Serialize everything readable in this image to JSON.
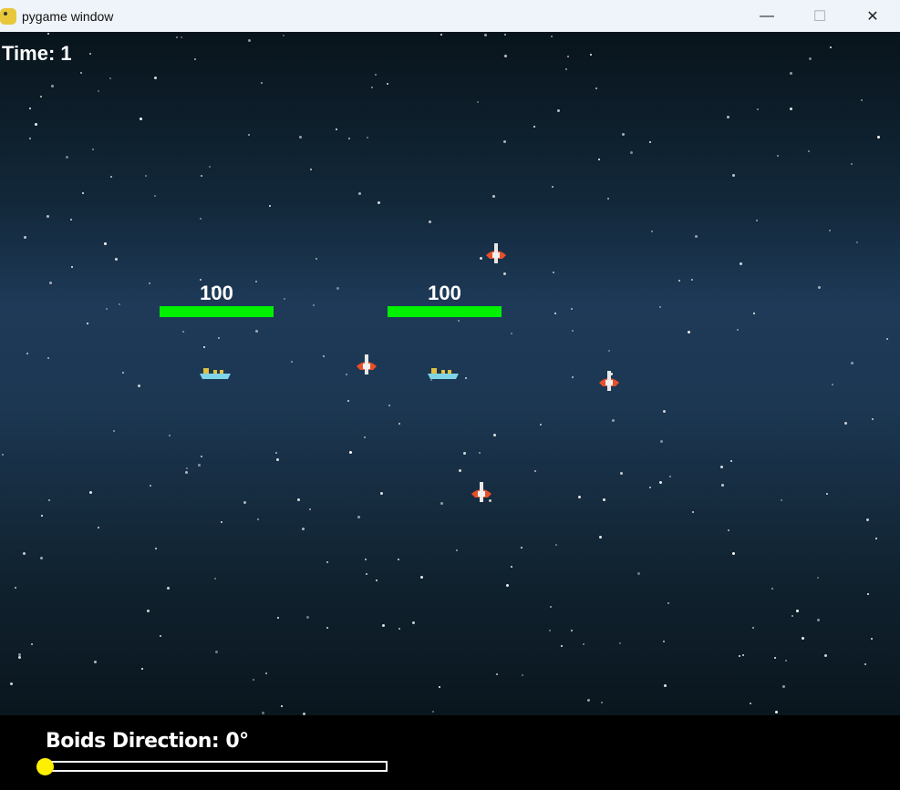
{
  "window": {
    "title": "pygame window",
    "controls": [
      "minimize",
      "maximize",
      "close"
    ]
  },
  "hud": {
    "time_label": "Time: 1"
  },
  "bases": [
    {
      "health": "100",
      "health_fraction": 1.0
    },
    {
      "health": "100",
      "health_fraction": 1.0
    }
  ],
  "slider": {
    "label": "Boids Direction: 0°",
    "value_deg": 0,
    "min_deg": 0,
    "max_deg": 360
  },
  "colors": {
    "health": "#00f000",
    "knob": "#ffef00"
  }
}
